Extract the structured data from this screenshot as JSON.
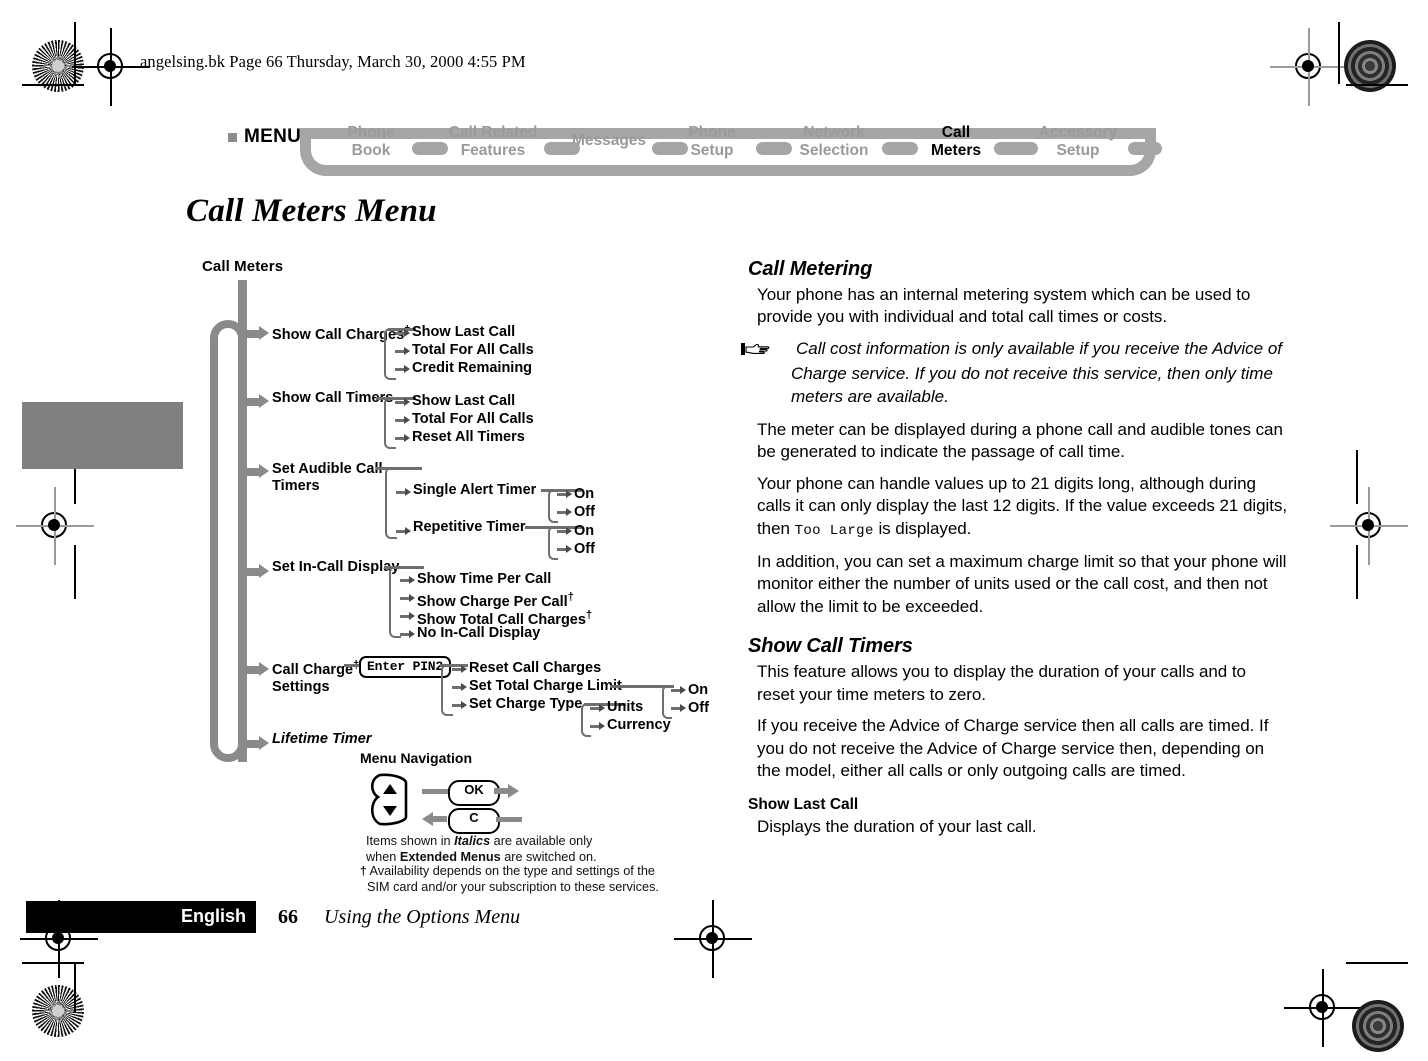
{
  "doc_header": "angelsing.bk  Page 66  Thursday, March 30, 2000  4:55 PM",
  "nav": {
    "menu_label": "MENU",
    "items": [
      {
        "line1": "Phone",
        "line2": "Book",
        "active": false
      },
      {
        "line1": "Call Related",
        "line2": "Features",
        "active": false
      },
      {
        "line1": "Messages",
        "line2": "",
        "active": false
      },
      {
        "line1": "Phone",
        "line2": "Setup",
        "active": false
      },
      {
        "line1": "Network",
        "line2": "Selection",
        "active": false
      },
      {
        "line1": "Call",
        "line2": "Meters",
        "active": true
      },
      {
        "line1": "Accessory",
        "line2": "Setup",
        "active": false
      }
    ]
  },
  "title": "Call Meters Menu",
  "tree": {
    "root": "Call Meters",
    "branches": [
      {
        "label": "Show Call Charges",
        "dagger": true,
        "italic": false
      },
      {
        "label": "Show Call Timers",
        "dagger": false,
        "italic": false
      },
      {
        "label": "Set Audible Call",
        "label2": "Timers",
        "dagger": false,
        "italic": false
      },
      {
        "label": "Set In-Call Display",
        "dagger": false,
        "italic": false
      },
      {
        "label": "Call Charge",
        "label2": "Settings",
        "dagger": true,
        "italic": false
      },
      {
        "label": "Lifetime Timer",
        "dagger": false,
        "italic": true
      }
    ],
    "charges_items": [
      "Show Last Call",
      "Total For All Calls",
      "Credit Remaining"
    ],
    "timers_items": [
      "Show Last Call",
      "Total For All Calls",
      "Reset All Timers"
    ],
    "audible_items": [
      "Single Alert Timer",
      "Repetitive Timer"
    ],
    "audible_onoff_1": [
      "On",
      "Off"
    ],
    "audible_onoff_2": [
      "On",
      "Off"
    ],
    "incall_items": [
      "Show Time Per Call",
      "Show Charge Per Call",
      "Show Total Call Charges",
      "No In-Call Display"
    ],
    "incall_daggers": [
      false,
      true,
      true,
      false
    ],
    "pin_box": "Enter PIN2",
    "charge_items": [
      "Reset Call Charges",
      "Set Total Charge Limit",
      "Set Charge Type"
    ],
    "charge_type_items": [
      "Units",
      "Currency"
    ],
    "limit_onoff": [
      "On",
      "Off"
    ]
  },
  "legend": {
    "heading": "Menu Navigation",
    "key_ok": "OK",
    "key_c": "C",
    "note_line1_a": "Items shown in ",
    "note_line1_i": "Italics",
    "note_line1_b": " are available only",
    "note_line2_a": "when ",
    "note_line2_b": "Extended Menus",
    "note_line2_c": " are switched on.",
    "dagger": "†",
    "note_line3": "Availability depends on the type and settings of the",
    "note_line4": "SIM card and/or your subscription to these services."
  },
  "content": {
    "h_call_metering": "Call Metering",
    "p1": "Your phone has an internal metering system which can be used to provide you with individual and total call times or costs.",
    "note1": "Call cost information is only available if you receive the Advice of Charge service. If you do not receive this service, then only time meters are available.",
    "p2": "The meter can be displayed during a phone call and audible tones can be generated to indicate the passage of call time.",
    "p3a": "Your phone can handle values up to 21 digits long, although during calls it can only display the last 12 digits. If the value exceeds 21 digits, then ",
    "p3_mono": "Too Large",
    "p3b": " is displayed.",
    "p4": "In addition, you can set a maximum charge limit so that your phone will monitor either the number of units used or the call cost, and then not allow the limit to be exceeded.",
    "h_show_call_timers": "Show Call Timers",
    "p5": "This feature allows you to display the duration of your calls and to reset your time meters to zero.",
    "p6": "If you receive the Advice of Charge service then all calls are timed. If you do not receive the Advice of Charge service then, depending on the model, either all calls or only outgoing calls are timed.",
    "h_show_last_call": "Show Last Call",
    "p7": "Displays the duration of your last call."
  },
  "footer": {
    "language": "English",
    "page_number": "66",
    "section": "Using the Options Menu"
  },
  "colors": {
    "nav_gray": "#a6a6a6",
    "tree_gray": "#8a8a8a",
    "bracket_gray": "#6f6f6f",
    "tab_gray": "#808080",
    "black": "#000000"
  }
}
